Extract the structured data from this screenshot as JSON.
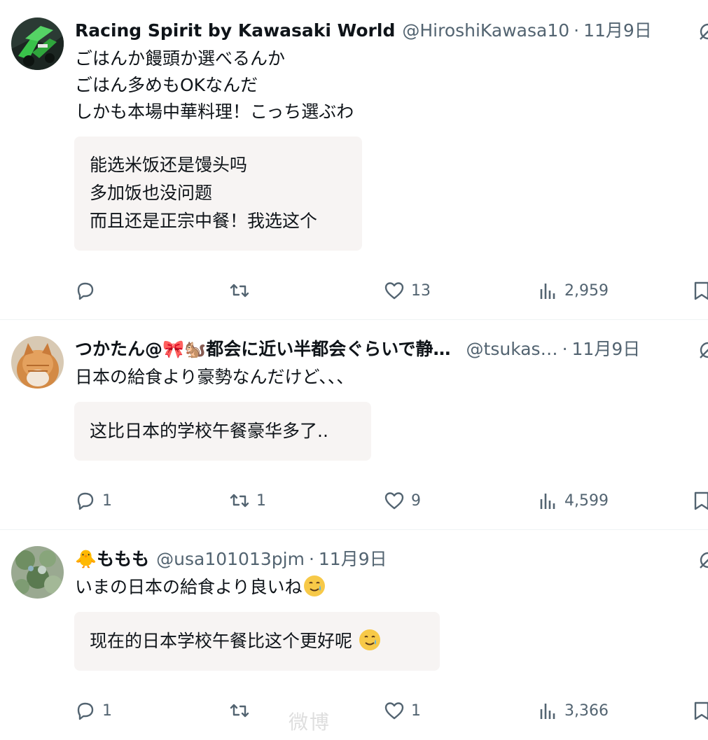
{
  "posts": [
    {
      "display_name": "Racing Spirit by Kawasaki World",
      "handle": "@HiroshiKawasa10",
      "separator": "·",
      "date": "11月9日",
      "avatar": "kawasaki-motorcycle-avatar",
      "text_lines": [
        "ごはんか饅頭か選べるんか",
        "ごはん多めもOKなんだ",
        "しかも本場中華料理！こっち選ぶわ"
      ],
      "translation_lines": [
        "能选米饭还是馒头吗",
        "多加饭也没问题",
        "而且还是正宗中餐！我选这个"
      ],
      "replies": "",
      "retweets": "",
      "likes": "13",
      "views": "2,959"
    },
    {
      "display_name": "つかたん@🎀🐿️都会に近い半都会ぐらいで静…",
      "handle": "@tsukas…",
      "separator": "·",
      "date": "11月9日",
      "avatar": "orange-cat-avatar",
      "text_lines": [
        "日本の給食より豪勢なんだけど、、、"
      ],
      "translation_lines": [
        "这比日本的学校午餐豪华多了.."
      ],
      "replies": "1",
      "retweets": "1",
      "likes": "9",
      "views": "4,599"
    },
    {
      "display_name": "🐥ももも",
      "handle": "@usa101013pjm",
      "separator": "·",
      "date": "11月9日",
      "avatar": "green-leaves-avatar",
      "text_lines": [
        "いまの日本の給食より良いね"
      ],
      "translation_lines": [
        "现在的日本学校午餐比这个更好呢"
      ],
      "inline_emoji": "smiling-face-with-tear-emoji",
      "replies": "1",
      "retweets": "",
      "likes": "1",
      "views": "3,366"
    }
  ],
  "watermark": "微博",
  "colors": {
    "text_primary": "#0f1419",
    "text_secondary": "#536471",
    "translation_bg": "#f7f4f3",
    "divider": "#eff3f4"
  },
  "icons": [
    "reply-icon",
    "retweet-icon",
    "like-icon",
    "views-icon",
    "bookmark-icon",
    "grok-icon"
  ]
}
